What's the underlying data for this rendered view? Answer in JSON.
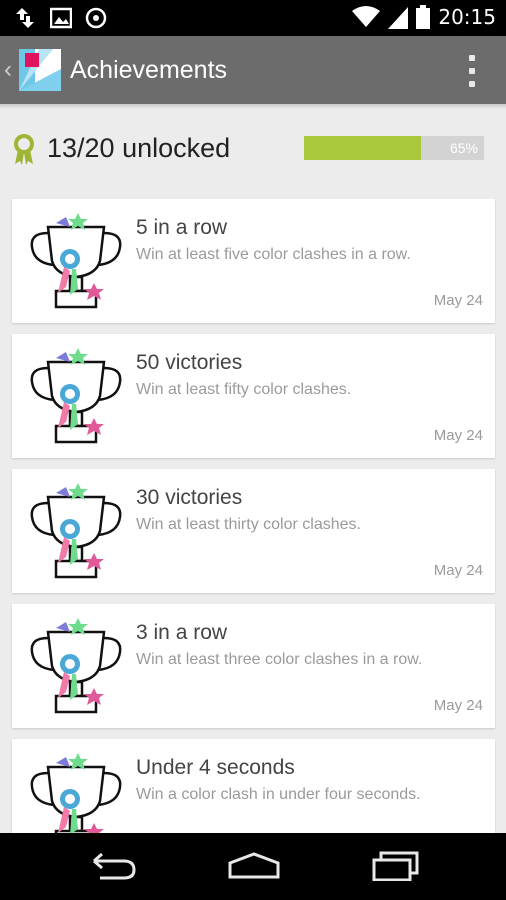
{
  "status_bar": {
    "time": "20:15",
    "icons": [
      "mobile-data-icon",
      "image-icon",
      "sync-icon",
      "wifi-icon",
      "signal-icon",
      "battery-icon"
    ]
  },
  "action_bar": {
    "title": "Achievements",
    "icons": [
      "back-icon",
      "app-logo",
      "overflow-menu-icon"
    ]
  },
  "progress": {
    "unlocked_text": "13/20 unlocked",
    "percent_label": "65%",
    "fraction": 0.65,
    "fill_color": "#aac83c"
  },
  "achievements": [
    {
      "title": "5 in a row",
      "description": "Win at least five color clashes in a row.",
      "date": "May 24"
    },
    {
      "title": "50 victories",
      "description": "Win at least fifty color clashes.",
      "date": "May 24"
    },
    {
      "title": "30 victories",
      "description": "Win at least thirty color clashes.",
      "date": "May 24"
    },
    {
      "title": "3 in a row",
      "description": "Win at least three color clashes in a row.",
      "date": "May 24"
    },
    {
      "title": "Under 4 seconds",
      "description": "Win a color clash in under four seconds.",
      "date": ""
    }
  ],
  "nav_bar": {
    "icons": [
      "back-nav-icon",
      "home-nav-icon",
      "recents-nav-icon"
    ]
  }
}
